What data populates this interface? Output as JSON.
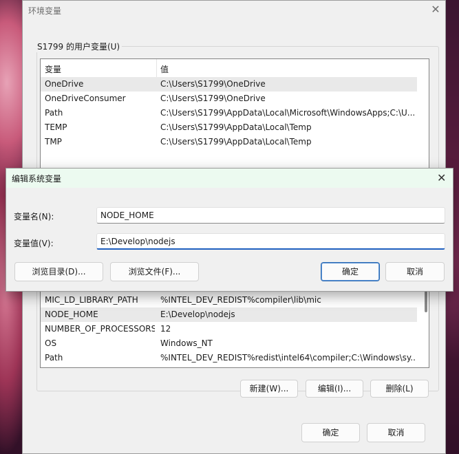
{
  "env_window": {
    "title": "环境变量",
    "user_group_label": "S1799 的用户变量(U)",
    "columns": [
      "变量",
      "值"
    ],
    "user_vars": [
      {
        "name": "OneDrive",
        "value": "C:\\Users\\S1799\\OneDrive"
      },
      {
        "name": "OneDriveConsumer",
        "value": "C:\\Users\\S1799\\OneDrive"
      },
      {
        "name": "Path",
        "value": "C:\\Users\\S1799\\AppData\\Local\\Microsoft\\WindowsApps;C:\\U..."
      },
      {
        "name": "TEMP",
        "value": "C:\\Users\\S1799\\AppData\\Local\\Temp"
      },
      {
        "name": "TMP",
        "value": "C:\\Users\\S1799\\AppData\\Local\\Temp"
      }
    ],
    "sys_vars": [
      {
        "name": "MIC_LD_LIBRARY_PATH",
        "value": "%INTEL_DEV_REDIST%compiler\\lib\\mic"
      },
      {
        "name": "NODE_HOME",
        "value": "E:\\Develop\\nodejs"
      },
      {
        "name": "NUMBER_OF_PROCESSORS",
        "value": "12"
      },
      {
        "name": "OS",
        "value": "Windows_NT"
      },
      {
        "name": "Path",
        "value": "%INTEL_DEV_REDIST%redist\\intel64\\compiler;C:\\Windows\\sy..."
      }
    ],
    "sys_buttons": {
      "new": "新建(W)...",
      "edit": "编辑(I)...",
      "delete": "删除(L)"
    },
    "ok": "确定",
    "cancel": "取消"
  },
  "edit_dialog": {
    "title": "编辑系统变量",
    "name_label": "变量名(N):",
    "value_label": "变量值(V):",
    "name_value": "NODE_HOME",
    "value_value": "E:\\Develop\\nodejs",
    "browse_dir": "浏览目录(D)...",
    "browse_file": "浏览文件(F)...",
    "ok": "确定",
    "cancel": "取消"
  },
  "colors": {
    "accent": "#1e5fbf",
    "title_bar": "#ecfaf0"
  }
}
